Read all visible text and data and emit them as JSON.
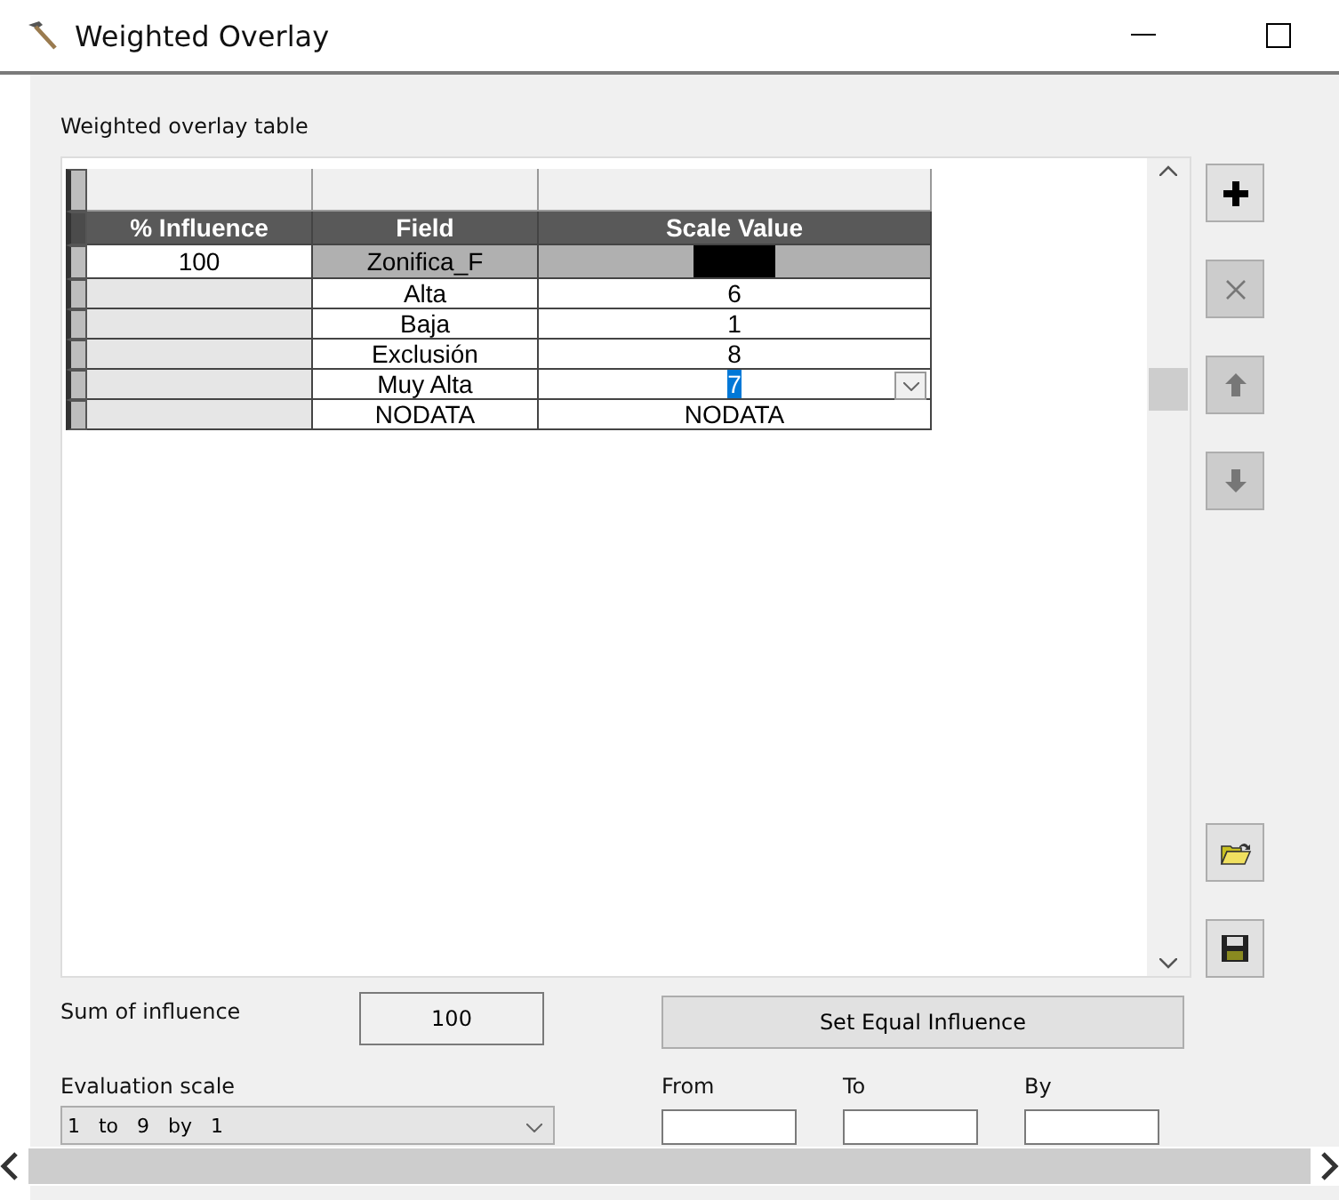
{
  "window": {
    "title": "Weighted Overlay"
  },
  "section_label": "Weighted overlay table",
  "table": {
    "columns": [
      "% Influence",
      "Field",
      "Scale Value"
    ],
    "raster": {
      "influence": "100",
      "field": "Zonifica_F"
    },
    "rows": [
      {
        "field": "Alta",
        "scale_value": "6",
        "editing": false
      },
      {
        "field": "Baja",
        "scale_value": "1",
        "editing": false
      },
      {
        "field": "Exclusión",
        "scale_value": "8",
        "editing": false
      },
      {
        "field": "Muy Alta",
        "scale_value": "7",
        "editing": true
      },
      {
        "field": "NODATA",
        "scale_value": "NODATA",
        "editing": false
      }
    ]
  },
  "tools": [
    {
      "kind": "add",
      "disabled": false
    },
    {
      "kind": "remove",
      "disabled": true
    },
    {
      "kind": "up",
      "disabled": true
    },
    {
      "kind": "down",
      "disabled": true
    },
    {
      "kind": "open",
      "disabled": false
    },
    {
      "kind": "save",
      "disabled": false
    }
  ],
  "sum_label": "Sum of influence",
  "sum_value": "100",
  "equal_button": "Set Equal Influence",
  "evaluation_label": "Evaluation scale",
  "evaluation_value": "1   to   9   by   1",
  "range_fields": [
    {
      "label": "From"
    },
    {
      "label": "To"
    },
    {
      "label": "By"
    }
  ]
}
